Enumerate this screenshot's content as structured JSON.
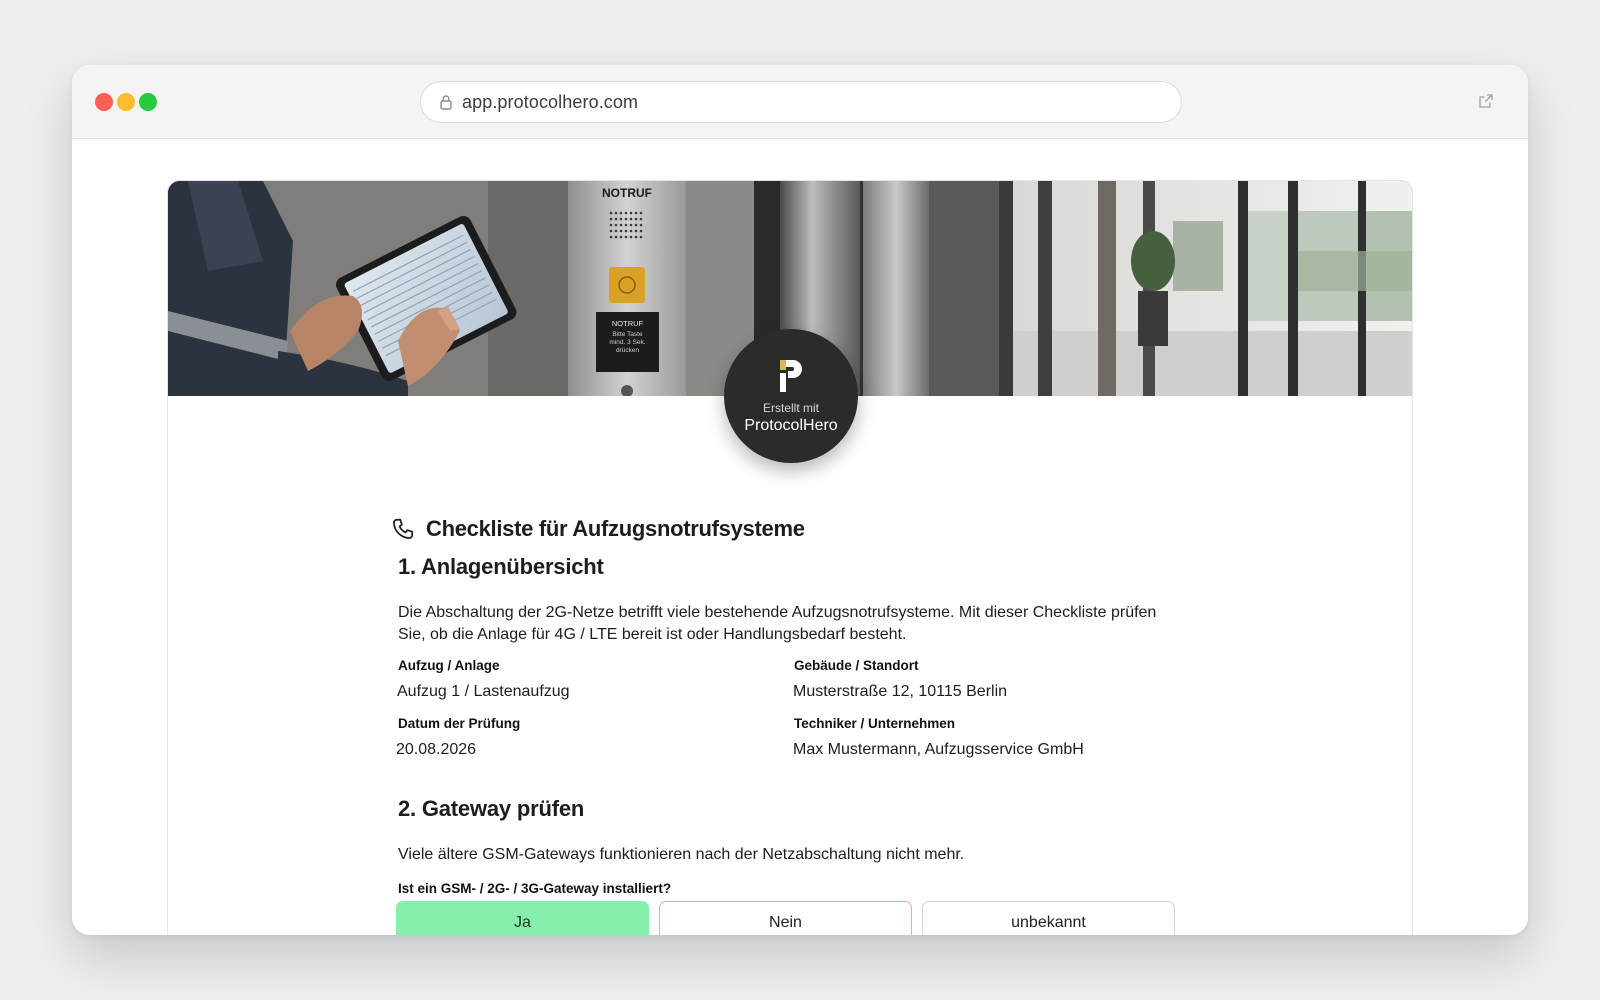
{
  "browser": {
    "url": "app.protocolhero.com"
  },
  "hero": {
    "panel_label": "NOTRUF",
    "panel_sign_text": "NOTRUF Bitte Taste mind. 3 Sek. drücken"
  },
  "badge": {
    "small_text": "Erstellt mit",
    "brand": "ProtocolHero"
  },
  "document": {
    "title": "Checkliste für Aufzugsnotrufsysteme",
    "section1": {
      "heading": "1. Anlagenübersicht",
      "description": "Die Abschaltung der 2G-Netze betrifft viele bestehende Aufzugsnotrufsysteme. Mit dieser Checkliste prüfen Sie, ob die Anlage für 4G / LTE bereit ist oder Handlungsbedarf besteht.",
      "fields": [
        {
          "label": "Aufzug / Anlage",
          "value": "Aufzug 1 / Lastenaufzug"
        },
        {
          "label": "Gebäude / Standort",
          "value": "Musterstraße 12, 10115 Berlin"
        },
        {
          "label": "Datum der Prüfung",
          "value": "20.08.2026"
        },
        {
          "label": "Techniker / Unternehmen",
          "value": "Max Mustermann, Aufzugsservice GmbH"
        }
      ]
    },
    "section2": {
      "heading": "2. Gateway prüfen",
      "description": "Viele ältere GSM-Gateways funktionieren nach der Netzabschaltung nicht mehr.",
      "question": "Ist ein GSM- / 2G- / 3G-Gateway installiert?",
      "options": [
        "Ja",
        "Nein",
        "unbekannt"
      ],
      "selected": "Ja"
    }
  },
  "colors": {
    "selected_option": "#86efac",
    "negative_option_border": "#f2a5a5",
    "badge_background": "#2b2b2b"
  }
}
